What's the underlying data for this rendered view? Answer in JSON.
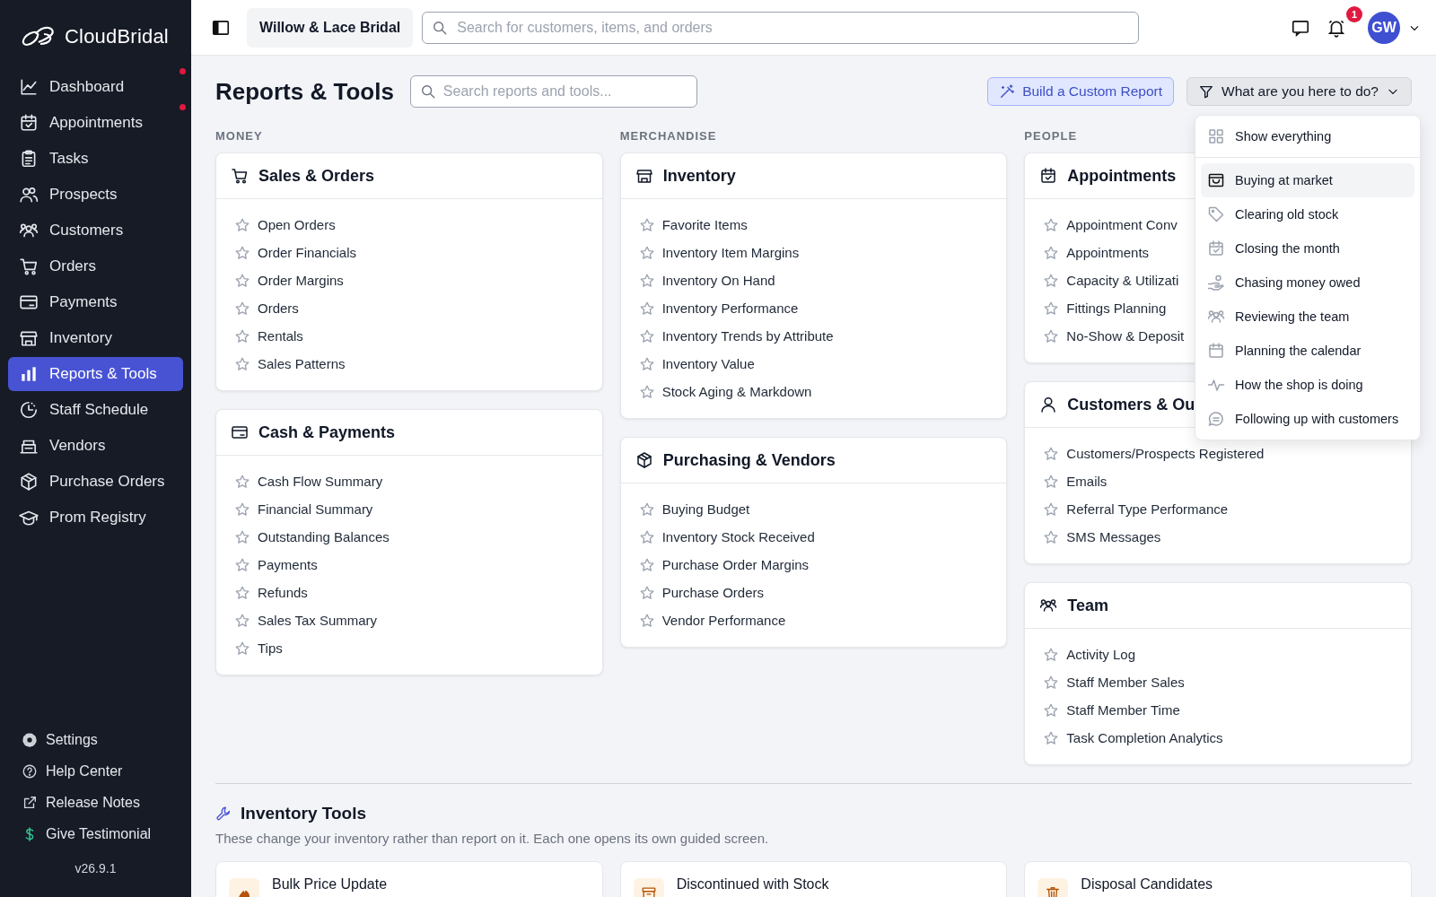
{
  "brand": {
    "name": "CloudBridal"
  },
  "sidebar": {
    "items": [
      {
        "label": "Dashboard",
        "selected": false,
        "dot": true
      },
      {
        "label": "Appointments",
        "selected": false,
        "dot": true
      },
      {
        "label": "Tasks",
        "selected": false,
        "dot": false
      },
      {
        "label": "Prospects",
        "selected": false,
        "dot": false
      },
      {
        "label": "Customers",
        "selected": false,
        "dot": false
      },
      {
        "label": "Orders",
        "selected": false,
        "dot": false
      },
      {
        "label": "Payments",
        "selected": false,
        "dot": false
      },
      {
        "label": "Inventory",
        "selected": false,
        "dot": false
      },
      {
        "label": "Reports & Tools",
        "selected": true,
        "dot": false
      },
      {
        "label": "Staff Schedule",
        "selected": false,
        "dot": false
      },
      {
        "label": "Vendors",
        "selected": false,
        "dot": false
      },
      {
        "label": "Purchase Orders",
        "selected": false,
        "dot": false
      },
      {
        "label": "Prom Registry",
        "selected": false,
        "dot": false
      }
    ],
    "footer": [
      "Settings",
      "Help Center",
      "Release Notes",
      "Give Testimonial"
    ],
    "version": "v26.9.1"
  },
  "topbar": {
    "store": "Willow & Lace Bridal",
    "search": {
      "placeholder": "Search for customers, items, and orders"
    },
    "notifications": "1",
    "avatar": "GW"
  },
  "page": {
    "title": "Reports & Tools",
    "search": {
      "placeholder": "Search reports and tools..."
    },
    "custom_report_button": "Build a Custom Report",
    "goal_button": "What are you here to do?"
  },
  "goal_menu": {
    "items": [
      {
        "label": "Show everything",
        "highlighted": false
      },
      {
        "label": "Buying at market",
        "highlighted": true
      },
      {
        "label": "Clearing old stock",
        "highlighted": false
      },
      {
        "label": "Closing the month",
        "highlighted": false
      },
      {
        "label": "Chasing money owed",
        "highlighted": false
      },
      {
        "label": "Reviewing the team",
        "highlighted": false
      },
      {
        "label": "Planning the calendar",
        "highlighted": false
      },
      {
        "label": "How the shop is doing",
        "highlighted": false
      },
      {
        "label": "Following up with customers",
        "highlighted": false
      }
    ]
  },
  "columns": [
    {
      "label": "MONEY",
      "cards": [
        {
          "title": "Sales & Orders",
          "items": [
            "Open Orders",
            "Order Financials",
            "Order Margins",
            "Orders",
            "Rentals",
            "Sales Patterns"
          ]
        },
        {
          "title": "Cash & Payments",
          "items": [
            "Cash Flow Summary",
            "Financial Summary",
            "Outstanding Balances",
            "Payments",
            "Refunds",
            "Sales Tax Summary",
            "Tips"
          ]
        }
      ]
    },
    {
      "label": "MERCHANDISE",
      "cards": [
        {
          "title": "Inventory",
          "items": [
            "Favorite Items",
            "Inventory Item Margins",
            "Inventory On Hand",
            "Inventory Performance",
            "Inventory Trends by Attribute",
            "Inventory Value",
            "Stock Aging & Markdown"
          ]
        },
        {
          "title": "Purchasing & Vendors",
          "items": [
            "Buying Budget",
            "Inventory Stock Received",
            "Purchase Order Margins",
            "Purchase Orders",
            "Vendor Performance"
          ]
        }
      ]
    },
    {
      "label": "PEOPLE",
      "cards": [
        {
          "title": "Appointments",
          "items": [
            "Appointment Conv",
            "Appointments",
            "Capacity & Utilizati",
            "Fittings Planning",
            "No-Show & Deposit"
          ]
        },
        {
          "title": "Customers & Ou",
          "items": [
            "Customers/Prospects Registered",
            "Emails",
            "Referral Type Performance",
            "SMS Messages"
          ]
        },
        {
          "title": "Team",
          "items": [
            "Activity Log",
            "Staff Member Sales",
            "Staff Member Time",
            "Task Completion Analytics"
          ]
        }
      ]
    }
  ],
  "tools": {
    "title": "Inventory Tools",
    "description": "These change your inventory rather than report on it. Each one opens its own guided screen.",
    "cards": [
      "Bulk Price Update",
      "Discontinued with Stock",
      "Disposal Candidates"
    ]
  }
}
